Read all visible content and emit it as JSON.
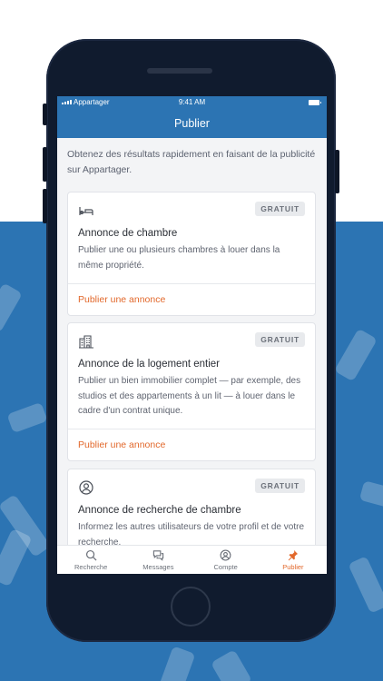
{
  "status_bar": {
    "carrier": "Appartager",
    "time": "9:41 AM"
  },
  "nav": {
    "title": "Publier"
  },
  "intro": "Obtenez des résultats rapidement en faisant de la publicité sur Appartager.",
  "cards": [
    {
      "icon": "bed-icon",
      "badge": "GRATUIT",
      "title": "Annonce de chambre",
      "description": "Publier une ou plusieurs chambres à louer dans la même propriété.",
      "action": "Publier une annonce"
    },
    {
      "icon": "building-icon",
      "badge": "GRATUIT",
      "title": "Annonce de la logement entier",
      "description": "Publier un bien immobilier complet — par exemple, des studios et des appartements à un lit — à louer dans le cadre d'un contrat unique.",
      "action": "Publier une annonce"
    },
    {
      "icon": "user-circle-icon",
      "badge": "GRATUIT",
      "title": "Annonce de recherche de chambre",
      "description": "Informez les autres utilisateurs de votre profil et de votre recherche."
    }
  ],
  "tabs": [
    {
      "label": "Recherche",
      "icon": "search-icon",
      "active": false
    },
    {
      "label": "Messages",
      "icon": "chat-icon",
      "active": false
    },
    {
      "label": "Compte",
      "icon": "account-icon",
      "active": false
    },
    {
      "label": "Publier",
      "icon": "pin-icon",
      "active": true
    }
  ],
  "colors": {
    "primary": "#2c74b3",
    "accent": "#e2682b",
    "phone": "#101b2e"
  }
}
